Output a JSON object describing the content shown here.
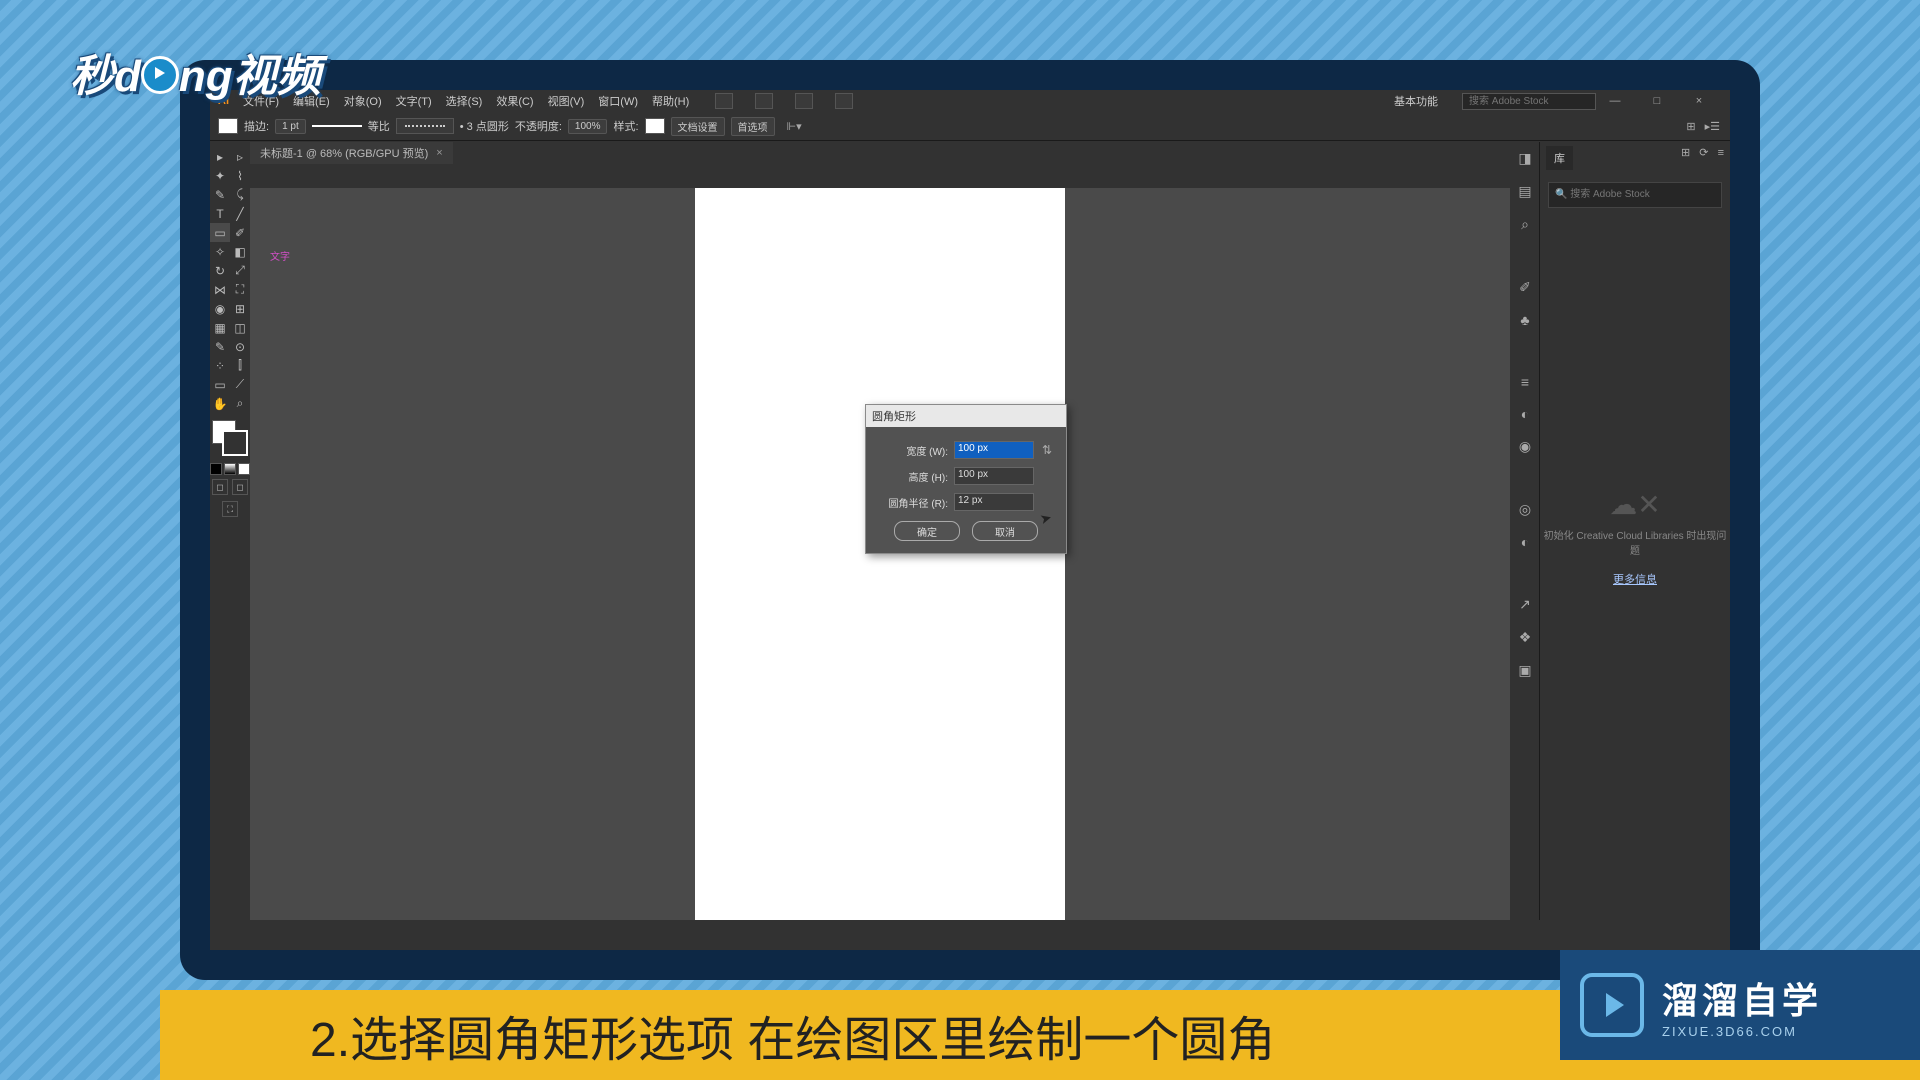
{
  "logo_top": "秒d  ng视频",
  "menu": {
    "file": "文件(F)",
    "edit": "编辑(E)",
    "object": "对象(O)",
    "type": "文字(T)",
    "select": "选择(S)",
    "effect": "效果(C)",
    "view": "视图(V)",
    "window": "窗口(W)",
    "help": "帮助(H)"
  },
  "workspace_label": "基本功能",
  "search_placeholder": "搜索 Adobe Stock",
  "options": {
    "stroke_label": "描边:",
    "stroke_width": "1 pt",
    "stroke_style": "等比",
    "points": "• 3 点圆形",
    "opacity_label": "不透明度:",
    "opacity": "100%",
    "style_label": "样式:",
    "doc_setup": "文档设置",
    "prefs": "首选项"
  },
  "tab": {
    "name": "未标题-1 @ 68% (RGB/GPU 预览)",
    "close": "×"
  },
  "canvas_text": "文字",
  "dialog": {
    "title": "圆角矩形",
    "width_label": "宽度 (W):",
    "width_val": "100 px",
    "height_label": "高度 (H):",
    "height_val": "100 px",
    "radius_label": "圆角半径 (R):",
    "radius_val": "12 px",
    "ok": "确定",
    "cancel": "取消"
  },
  "libraries": {
    "tab": "库",
    "search_placeholder": "搜索 Adobe Stock",
    "empty": "初始化 Creative Cloud Libraries 时出现问题",
    "link": "更多信息"
  },
  "caption": "2.选择圆角矩形选项 在绘图区里绘制一个圆角",
  "brand": {
    "main": "溜溜自学",
    "sub": "ZIXUE.3D66.COM"
  }
}
